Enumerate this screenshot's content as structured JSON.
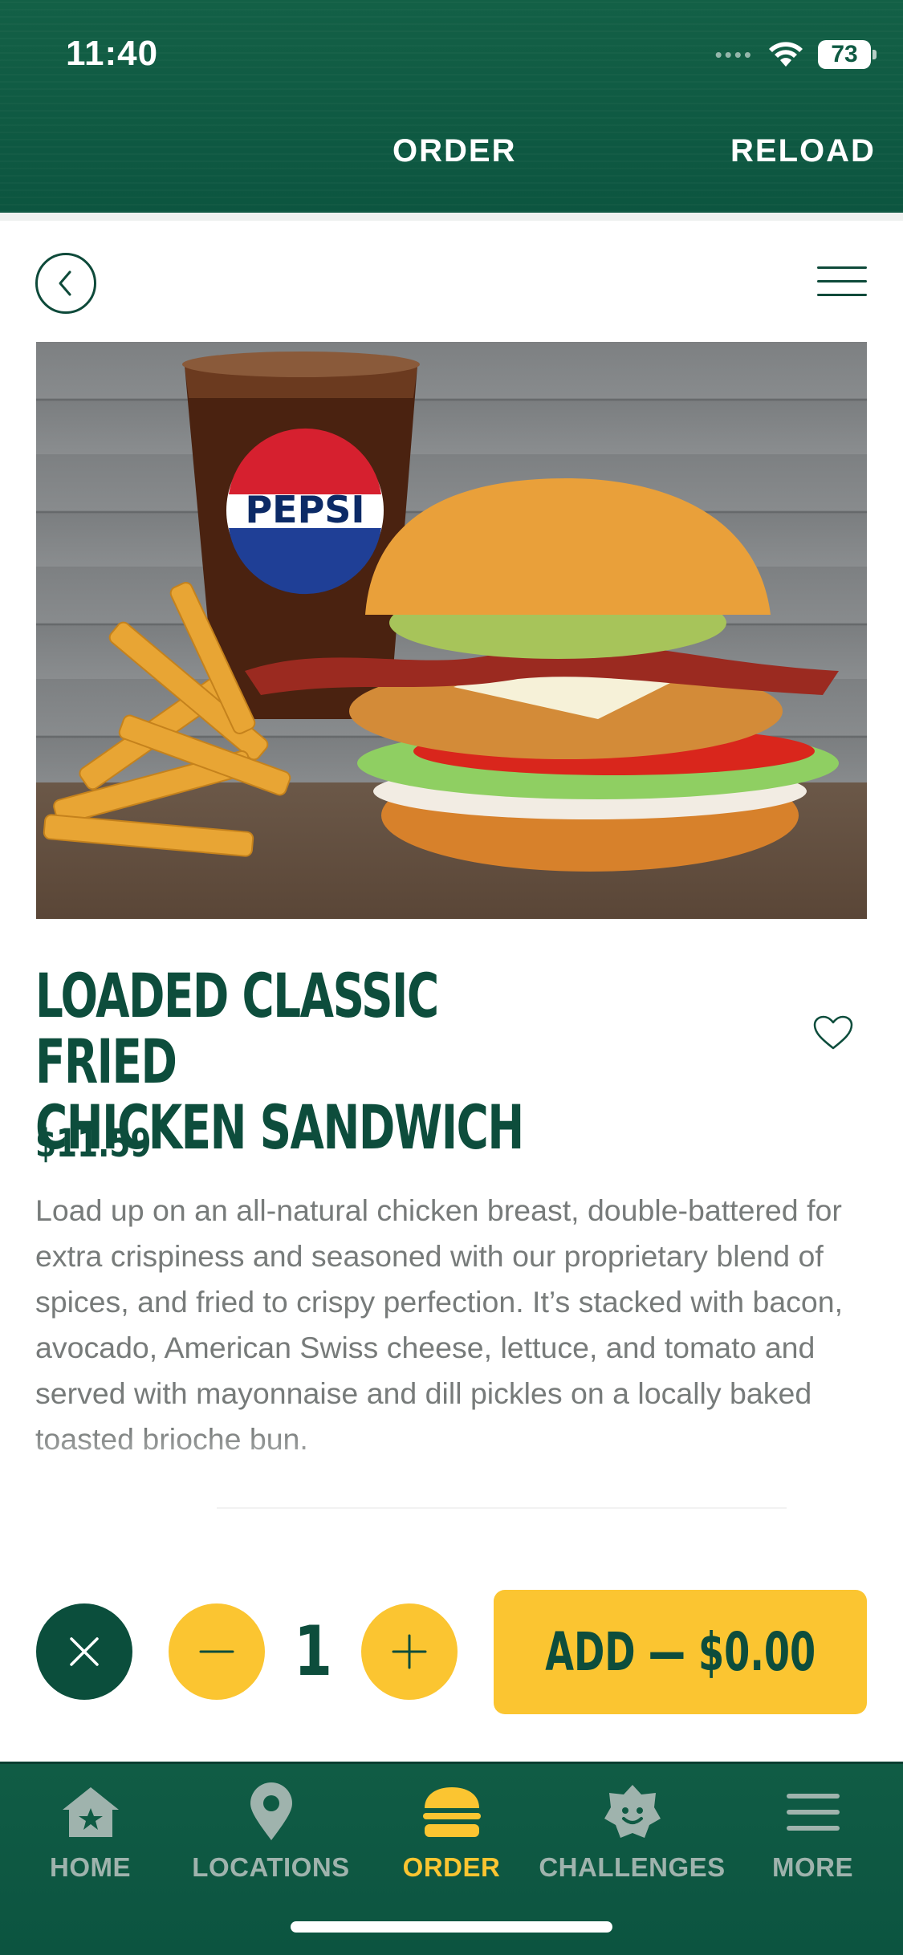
{
  "status": {
    "time": "11:40",
    "battery": "73"
  },
  "header": {
    "order_label": "ORDER",
    "reload_label": "RELOAD"
  },
  "product": {
    "title_line1": "LOADED CLASSIC FRIED",
    "title_line2": "CHICKEN SANDWICH",
    "price": "$11.59",
    "description": "Load up on an all-natural chicken breast, double-battered for extra crispiness and seasoned with our proprietary blend of spices, and fried to crispy perfection. It’s stacked with bacon, avocado, American Swiss cheese, lettuce, and tomato and served with mayonnaise and dill pickles on a locally baked toasted brioche bun.",
    "cup_brand": "PEPSI"
  },
  "actions": {
    "quantity": "1",
    "add_label": "ADD — $0.00"
  },
  "tabbar": {
    "items": [
      {
        "label": "HOME",
        "icon": "home-star-icon"
      },
      {
        "label": "LOCATIONS",
        "icon": "location-pin-icon"
      },
      {
        "label": "ORDER",
        "icon": "burger-icon",
        "active": true
      },
      {
        "label": "CHALLENGES",
        "icon": "challenge-badge-icon"
      },
      {
        "label": "MORE",
        "icon": "menu-lines-icon"
      }
    ]
  },
  "colors": {
    "brand_green": "#0f5a43",
    "accent_yellow": "#fbc531",
    "text_green": "#0d4d3c"
  }
}
